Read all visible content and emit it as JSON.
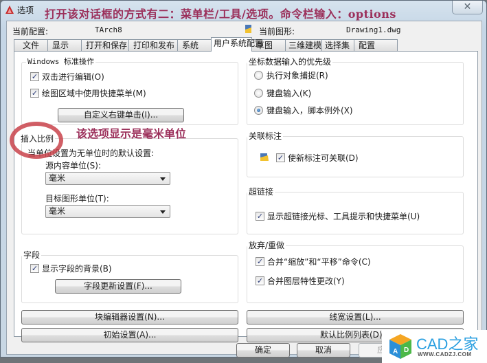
{
  "window": {
    "title": "选项",
    "close_symbol": "✕",
    "annotation": "打开该对话框的方式有二：菜单栏/工具/选项。命令栏输入：options"
  },
  "header": {
    "profile_label": "当前配置:",
    "profile_value": "TArch8",
    "drawing_label": "当前图形:",
    "drawing_value": "Drawing1.dwg"
  },
  "tabs": [
    {
      "label": "文件",
      "active": false
    },
    {
      "label": "显示",
      "active": false
    },
    {
      "label": "打开和保存",
      "active": false
    },
    {
      "label": "打印和发布",
      "active": false
    },
    {
      "label": "系统",
      "active": false
    },
    {
      "label": "用户系统配置",
      "active": true
    },
    {
      "label": "草图",
      "active": false
    },
    {
      "label": "三维建模",
      "active": false
    },
    {
      "label": "选择集",
      "active": false
    },
    {
      "label": "配置",
      "active": false
    }
  ],
  "windows_ops": {
    "title": "Windows 标准操作",
    "double_click_edit": {
      "label": "双击进行编辑(O)",
      "checked": true
    },
    "shortcut_menu": {
      "label": "绘图区域中使用快捷菜单(M)",
      "checked": true
    },
    "right_click_button": "自定义右键单击(I)..."
  },
  "insert_scale": {
    "title": "插入比例",
    "description": "当单位设置为无单位时的默认设置:",
    "source_label": "源内容单位(S):",
    "source_value": "毫米",
    "target_label": "目标图形单位(T):",
    "target_value": "毫米",
    "annotation": "该选项显示是毫米单位"
  },
  "fields": {
    "title": "字段",
    "show_background": {
      "label": "显示字段的背景(B)",
      "checked": true
    },
    "update_button": "字段更新设置(F)..."
  },
  "coord_priority": {
    "title": "坐标数据输入的优先级",
    "options": [
      {
        "label": "执行对象捕捉(R)",
        "selected": false
      },
      {
        "label": "键盘输入(K)",
        "selected": false
      },
      {
        "label": "键盘输入，脚本例外(X)",
        "selected": true
      }
    ]
  },
  "assoc_dim": {
    "title": "关联标注",
    "make_associative": {
      "label": "使新标注可关联(D)",
      "checked": true
    }
  },
  "hyperlink": {
    "title": "超链接",
    "show_cursor": {
      "label": "显示超链接光标、工具提示和快捷菜单(U)",
      "checked": true
    }
  },
  "undo_redo": {
    "title": "放弃/重做",
    "combine_zoom_pan": {
      "label": "合并“缩放”和“平移”命令(C)",
      "checked": true
    },
    "combine_layer": {
      "label": "合并图层特性更改(Y)",
      "checked": true
    }
  },
  "buttons": {
    "block_editor": "块编辑器设置(N)...",
    "initial_setup": "初始设置(A)...",
    "lineweight": "线宽设置(L)...",
    "scale_list": "默认比例列表(D)...",
    "ok": "确定",
    "cancel": "取消",
    "apply": "应用"
  },
  "watermark": {
    "title": "CAD之家",
    "url": "WWW.CADZJ.COM"
  },
  "check_symbol": "✓"
}
